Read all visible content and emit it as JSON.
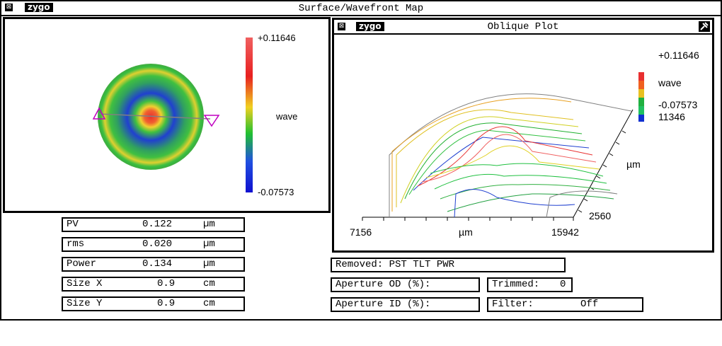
{
  "window": {
    "title": "Surface/Wavefront Map",
    "logo": "zygo",
    "close_glyph": "⊠"
  },
  "surface_map": {
    "colorbar_max": "+0.11646",
    "colorbar_min": "-0.07573",
    "colorbar_unit": "wave"
  },
  "oblique_plot": {
    "title": "Oblique Plot",
    "logo": "zygo",
    "close_glyph": "⊠",
    "colorbar_max": "+0.11646",
    "colorbar_min": "-0.07573",
    "colorbar_unit": "wave",
    "colorbar_extra": "11346",
    "x_axis_min": "7156",
    "x_axis_max": "15942",
    "x_axis_unit": "µm",
    "y_axis_unit": "µm",
    "y_axis_value": "2560"
  },
  "results": [
    {
      "label": "PV",
      "value": "0.122",
      "unit": "µm"
    },
    {
      "label": "rms",
      "value": "0.020",
      "unit": "µm"
    },
    {
      "label": "Power",
      "value": "0.134",
      "unit": "µm"
    },
    {
      "label": "Size X",
      "value": "0.9",
      "unit": "cm"
    },
    {
      "label": "Size Y",
      "value": "0.9",
      "unit": "cm"
    }
  ],
  "info": {
    "removed": "Removed: PST TLT PWR",
    "aperture_od": "Aperture OD (%):",
    "aperture_id": "Aperture ID (%):",
    "trimmed_label": "Trimmed:",
    "trimmed_value": "0",
    "filter_label": "Filter:",
    "filter_value": "Off"
  },
  "colors": {
    "red": "#e83030",
    "orange": "#f5a020",
    "yellow": "#e8e020",
    "green": "#20c040",
    "blue": "#1030d0"
  }
}
